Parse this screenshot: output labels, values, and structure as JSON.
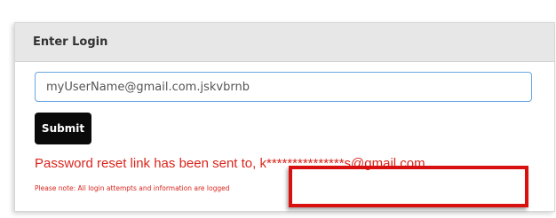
{
  "panel": {
    "title": "Enter Login"
  },
  "form": {
    "login_value": "myUserName@gmail.com.jskvbrnb",
    "submit_label": "Submit"
  },
  "messages": {
    "reset_prefix": "Password reset link has been sent to",
    "reset_separator": ", ",
    "masked_email": "k***************s@gmail.com",
    "note": "Please note: All login attempts and information are logged"
  },
  "colors": {
    "error_text": "#d9261c",
    "highlight_border": "#d81010",
    "submit_background": "#0a0a0a",
    "header_background": "#e7e7e7"
  }
}
